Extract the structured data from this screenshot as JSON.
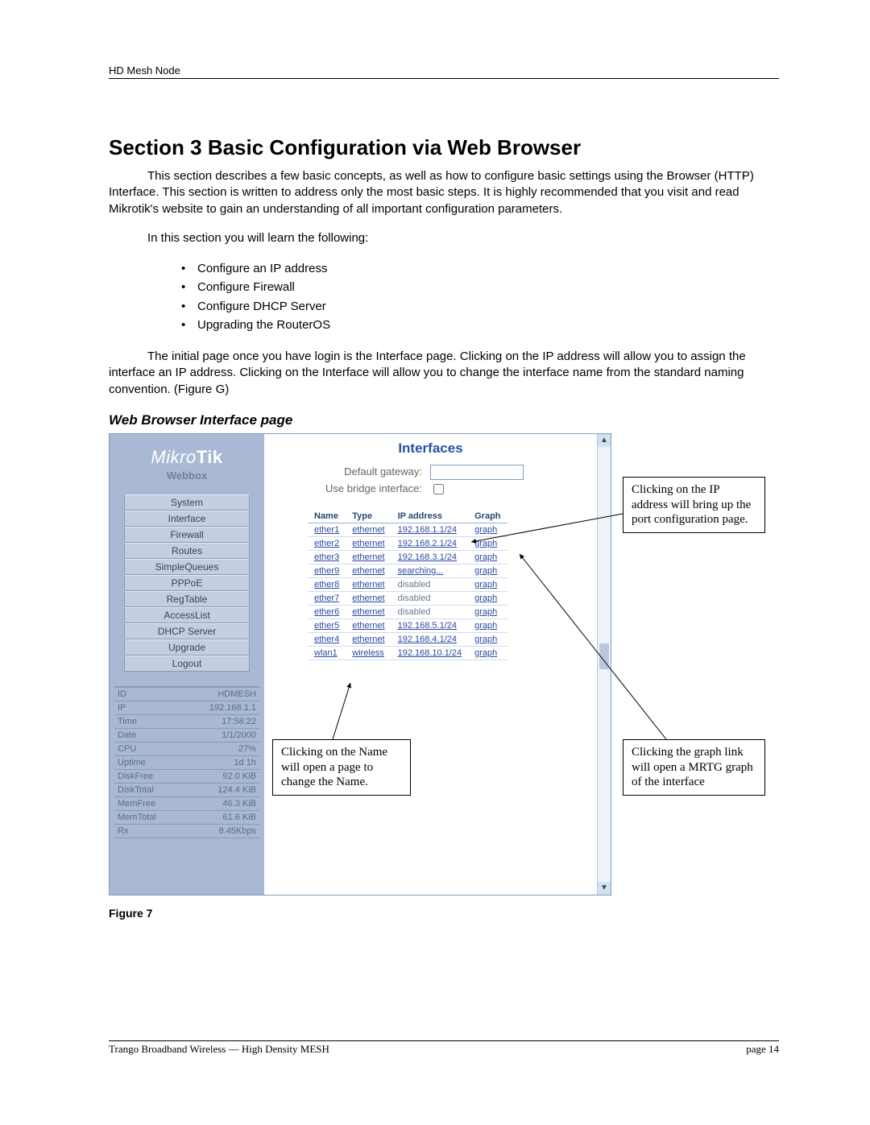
{
  "header": {
    "running": "HD Mesh Node"
  },
  "section": {
    "title": "Section 3 Basic Configuration via Web Browser",
    "intro": "This section describes a few basic concepts, as well as how to configure basic settings using the Browser (HTTP) Interface.  This section is written to address only the most basic steps.  It is highly recommended that you visit and read Mikrotik's website to gain an understanding of all important configuration parameters.",
    "learn_intro": "In this section you will learn the following:",
    "learn": [
      "Configure an IP address",
      "Configure Firewall",
      "Configure DHCP Server",
      "Upgrading the RouterOS"
    ],
    "after": "The initial page once you have login is the Interface page. Clicking on the IP address will allow you to assign the interface an IP address. Clicking on the Interface will allow you to change the interface name from the standard naming convention. (Figure G)",
    "sub_heading": "Web Browser Interface page",
    "figure_label": "Figure 7"
  },
  "webbox": {
    "brand_prefix": "Mikro",
    "brand_bold": "Tik",
    "subtitle": "Webbox",
    "menu": [
      "System",
      "Interface",
      "Firewall",
      "Routes",
      "SimpleQueues",
      "PPPoE",
      "RegTable",
      "AccessList",
      "DHCP Server",
      "Upgrade",
      "Logout"
    ],
    "stats": [
      [
        "ID",
        "HDMESH"
      ],
      [
        "IP",
        "192.168.1.1"
      ],
      [
        "Time",
        "17:58:22"
      ],
      [
        "Date",
        "1/1/2000"
      ],
      [
        "CPU",
        "27%"
      ],
      [
        "Uptime",
        "1d 1h"
      ],
      [
        "DiskFree",
        "92.0 KiB"
      ],
      [
        "DiskTotal",
        "124.4 KiB"
      ],
      [
        "MemFree",
        "46.3 KiB"
      ],
      [
        "MemTotal",
        "61.6 KiB"
      ],
      [
        "Rx",
        "8.45Kbps"
      ]
    ],
    "content_title": "Interfaces",
    "gateway_label": "Default gateway:",
    "bridge_label": "Use bridge interface:",
    "columns": [
      "Name",
      "Type",
      "IP address",
      "Graph"
    ],
    "rows": [
      {
        "name": "ether1",
        "type": "ethernet",
        "ip": "192.168.1.1/24",
        "ip_link": true,
        "graph": "graph"
      },
      {
        "name": "ether2",
        "type": "ethernet",
        "ip": "192.168.2.1/24",
        "ip_link": true,
        "graph": "graph"
      },
      {
        "name": "ether3",
        "type": "ethernet",
        "ip": "192.168.3.1/24",
        "ip_link": true,
        "graph": "graph"
      },
      {
        "name": "ether9",
        "type": "ethernet",
        "ip": "searching...",
        "ip_link": true,
        "graph": "graph"
      },
      {
        "name": "ether8",
        "type": "ethernet",
        "ip": "disabled",
        "ip_link": false,
        "graph": "graph"
      },
      {
        "name": "ether7",
        "type": "ethernet",
        "ip": "disabled",
        "ip_link": false,
        "graph": "graph"
      },
      {
        "name": "ether6",
        "type": "ethernet",
        "ip": "disabled",
        "ip_link": false,
        "graph": "graph"
      },
      {
        "name": "ether5",
        "type": "ethernet",
        "ip": "192.168.5.1/24",
        "ip_link": true,
        "graph": "graph"
      },
      {
        "name": "ether4",
        "type": "ethernet",
        "ip": "192.168.4.1/24",
        "ip_link": true,
        "graph": "graph"
      },
      {
        "name": "wlan1",
        "type": "wireless",
        "ip": "192.168.10.1/24",
        "ip_link": true,
        "graph": "graph"
      }
    ]
  },
  "callouts": {
    "ip": "Clicking on the IP address will bring up the port configuration page.",
    "name": "Clicking on the Name will open a page to change the Name.",
    "graph": "Clicking the graph link will open a MRTG graph of the interface"
  },
  "footer": {
    "left": "Trango Broadband Wireless — High Density MESH",
    "right": "page 14"
  }
}
